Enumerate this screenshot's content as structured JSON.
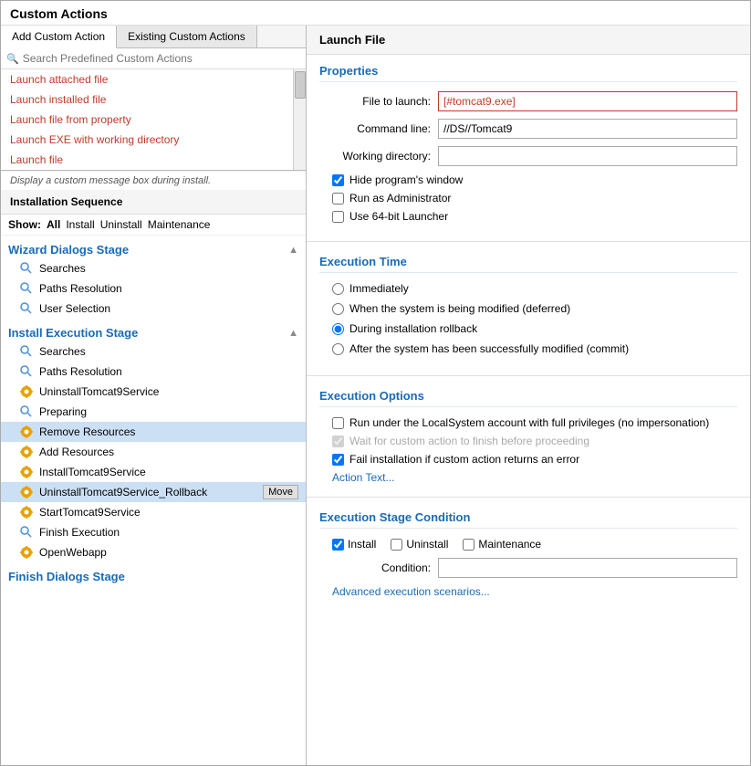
{
  "app": {
    "title": "Custom Actions"
  },
  "leftPanel": {
    "tabs": [
      {
        "id": "add",
        "label": "Add Custom Action",
        "active": true
      },
      {
        "id": "existing",
        "label": "Existing Custom Actions",
        "active": false
      }
    ],
    "search": {
      "placeholder": "Search Predefined Custom Actions"
    },
    "actionItems": [
      {
        "id": "launch-attached",
        "label": "Launch attached file"
      },
      {
        "id": "launch-installed",
        "label": "Launch installed file"
      },
      {
        "id": "launch-from-property",
        "label": "Launch file from property"
      },
      {
        "id": "launch-exe-working",
        "label": "Launch EXE with working directory"
      },
      {
        "id": "launch-file",
        "label": "Launch file"
      }
    ],
    "actionDescription": "Display a custom message box during install.",
    "installSequenceHeader": "Installation Sequence",
    "showBar": {
      "label": "Show:",
      "options": [
        "All",
        "Install",
        "Uninstall",
        "Maintenance"
      ],
      "active": "All"
    },
    "stages": [
      {
        "id": "wizard-dialogs",
        "title": "Wizard Dialogs Stage",
        "items": [
          {
            "id": "searches-1",
            "label": "Searches",
            "iconType": "blue-arrow"
          },
          {
            "id": "paths-resolution-1",
            "label": "Paths Resolution",
            "iconType": "blue-arrow"
          },
          {
            "id": "user-selection",
            "label": "User Selection",
            "iconType": "blue-arrow"
          }
        ]
      },
      {
        "id": "install-execution",
        "title": "Install Execution Stage",
        "items": [
          {
            "id": "searches-2",
            "label": "Searches",
            "iconType": "blue-arrow"
          },
          {
            "id": "paths-resolution-2",
            "label": "Paths Resolution",
            "iconType": "blue-arrow"
          },
          {
            "id": "uninstall-tomcat9-service",
            "label": "UninstallTomcat9Service",
            "iconType": "gear"
          },
          {
            "id": "preparing",
            "label": "Preparing",
            "iconType": "blue-arrow"
          },
          {
            "id": "remove-resources",
            "label": "Remove Resources",
            "iconType": "gear",
            "selected": true
          },
          {
            "id": "add-resources",
            "label": "Add Resources",
            "iconType": "gear"
          },
          {
            "id": "install-tomcat9-service",
            "label": "InstallTomcat9Service",
            "iconType": "gear"
          },
          {
            "id": "uninstall-rollback",
            "label": "UninstallTomcat9Service_Rollback",
            "iconType": "gear",
            "hasMove": true
          },
          {
            "id": "start-tomcat9",
            "label": "StartTomcat9Service",
            "iconType": "gear"
          },
          {
            "id": "finish-execution",
            "label": "Finish Execution",
            "iconType": "blue-arrow"
          },
          {
            "id": "open-webapp",
            "label": "OpenWebapp",
            "iconType": "gear"
          }
        ]
      },
      {
        "id": "finish-dialogs",
        "title": "Finish Dialogs Stage",
        "items": []
      }
    ]
  },
  "rightPanel": {
    "header": "Launch File",
    "sections": {
      "properties": {
        "title": "Properties",
        "fields": {
          "fileToLaunch": {
            "label": "File to launch:",
            "value": "[#tomcat9.exe]",
            "highlight": true
          },
          "commandLine": {
            "label": "Command line:",
            "value": "//DS//Tomcat9"
          },
          "workingDirectory": {
            "label": "Working directory:",
            "value": ""
          }
        },
        "checkboxes": [
          {
            "id": "hide-window",
            "label": "Hide program's window",
            "checked": true
          },
          {
            "id": "run-admin",
            "label": "Run as Administrator",
            "checked": false
          },
          {
            "id": "use-64bit",
            "label": "Use 64-bit Launcher",
            "checked": false
          }
        ]
      },
      "executionTime": {
        "title": "Execution Time",
        "radios": [
          {
            "id": "immediately",
            "label": "Immediately",
            "checked": false
          },
          {
            "id": "being-modified",
            "label": "When the system is being modified (deferred)",
            "checked": false
          },
          {
            "id": "rollback",
            "label": "During installation rollback",
            "checked": true
          },
          {
            "id": "after-modified",
            "label": "After the system has been successfully modified (commit)",
            "checked": false
          }
        ]
      },
      "executionOptions": {
        "title": "Execution Options",
        "checkboxes": [
          {
            "id": "run-local-system",
            "label": "Run under the LocalSystem account with full privileges (no impersonation)",
            "checked": false,
            "disabled": false
          },
          {
            "id": "wait-for-action",
            "label": "Wait for custom action to finish before proceeding",
            "checked": true,
            "disabled": true
          },
          {
            "id": "fail-installation",
            "label": "Fail installation if custom action returns an error",
            "checked": true,
            "disabled": false
          }
        ],
        "actionTextLink": "Action Text..."
      },
      "executionStageCondition": {
        "title": "Execution Stage Condition",
        "conditionCheckboxes": [
          {
            "id": "cond-install",
            "label": "Install",
            "checked": true
          },
          {
            "id": "cond-uninstall",
            "label": "Uninstall",
            "checked": false
          },
          {
            "id": "cond-maintenance",
            "label": "Maintenance",
            "checked": false
          }
        ],
        "conditionLabel": "Condition:",
        "conditionValue": "",
        "advancedLink": "Advanced execution scenarios..."
      }
    }
  }
}
